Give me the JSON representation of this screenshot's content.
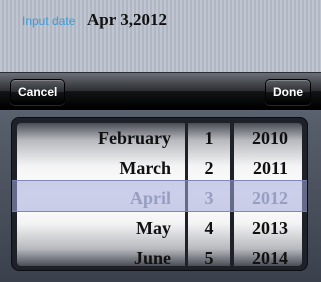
{
  "header": {
    "label": "Input date",
    "value": "Apr 3,2012"
  },
  "toolbar": {
    "cancel_label": "Cancel",
    "done_label": "Done"
  },
  "picker": {
    "months": [
      "February",
      "March",
      "April",
      "May",
      "June"
    ],
    "days": [
      "1",
      "2",
      "3",
      "4",
      "5"
    ],
    "years": [
      "2010",
      "2011",
      "2012",
      "2013",
      "2014"
    ],
    "selected": {
      "month": "April",
      "day": "3",
      "year": "2012"
    }
  },
  "colors": {
    "label_accent": "#3b9ad6",
    "selection_band": "#a0a8d7"
  }
}
